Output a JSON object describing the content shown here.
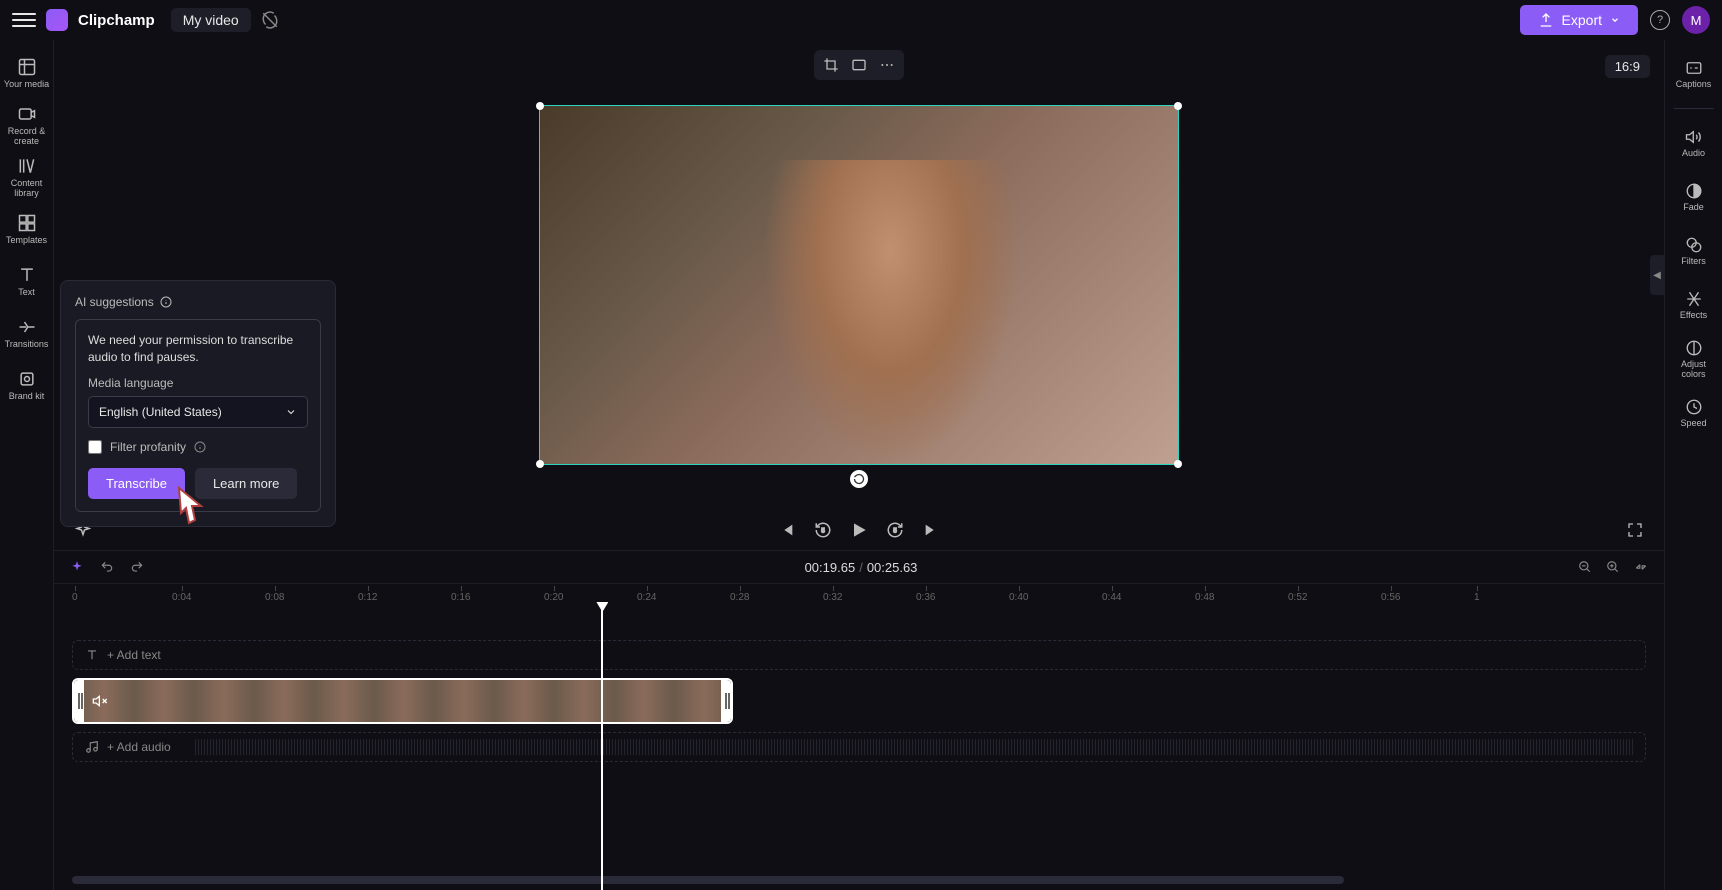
{
  "header": {
    "brand": "Clipchamp",
    "project": "My video",
    "export": "Export",
    "avatar_initial": "M"
  },
  "left_nav": [
    {
      "label": "Your media",
      "icon": "media-icon"
    },
    {
      "label": "Record & create",
      "icon": "record-icon"
    },
    {
      "label": "Content library",
      "icon": "library-icon"
    },
    {
      "label": "Templates",
      "icon": "templates-icon"
    },
    {
      "label": "Text",
      "icon": "text-icon"
    },
    {
      "label": "Transitions",
      "icon": "transitions-icon"
    },
    {
      "label": "Brand kit",
      "icon": "brand-icon"
    }
  ],
  "right_nav": [
    {
      "label": "Captions",
      "icon": "captions-icon"
    },
    {
      "label": "Audio",
      "icon": "audio-icon"
    },
    {
      "label": "Fade",
      "icon": "fade-icon"
    },
    {
      "label": "Filters",
      "icon": "filters-icon"
    },
    {
      "label": "Effects",
      "icon": "effects-icon"
    },
    {
      "label": "Adjust colors",
      "icon": "adjust-icon"
    },
    {
      "label": "Speed",
      "icon": "speed-icon"
    }
  ],
  "preview": {
    "aspect_ratio": "16:9"
  },
  "ai_panel": {
    "title": "AI suggestions",
    "message": "We need your permission to transcribe audio to find pauses.",
    "language_label": "Media language",
    "language_value": "English (United States)",
    "filter_label": "Filter profanity",
    "primary_btn": "Transcribe",
    "secondary_btn": "Learn more"
  },
  "timeline": {
    "current": "00:19.65",
    "total": "00:25.63",
    "ticks": [
      "0",
      "0:04",
      "0:08",
      "0:12",
      "0:16",
      "0:20",
      "0:24",
      "0:28",
      "0:32",
      "0:36",
      "0:40",
      "0:44",
      "0:48",
      "0:52",
      "0:56",
      "1"
    ],
    "add_text": "+ Add text",
    "add_audio": "+ Add audio"
  }
}
